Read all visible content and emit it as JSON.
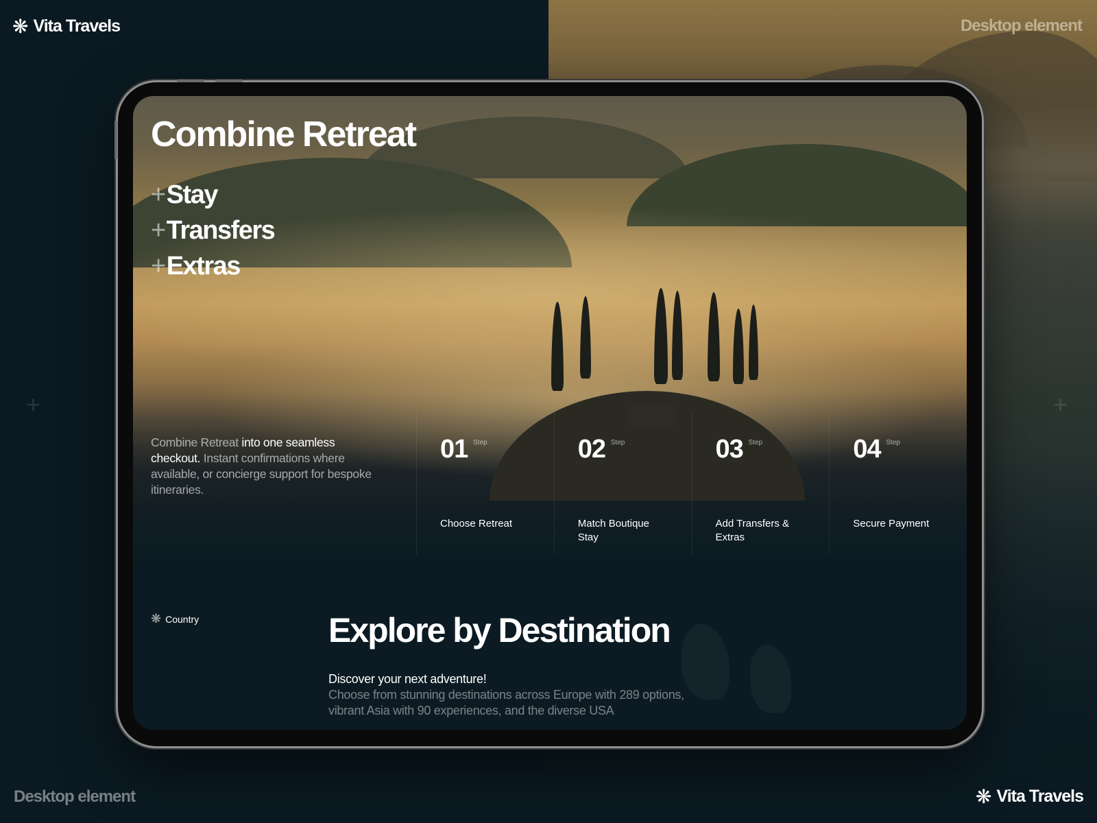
{
  "brand": {
    "name": "Vita Travels",
    "icon": "snowflake-asterisk-icon",
    "glyph": "❋"
  },
  "corner_labels": {
    "top_right": "Desktop element",
    "bottom_left": "Desktop element"
  },
  "hero": {
    "title": "Combine Retreat",
    "items": [
      {
        "plus": "+",
        "label": "Stay"
      },
      {
        "plus": "+",
        "label": "Transfers"
      },
      {
        "plus": "+",
        "label": "Extras"
      }
    ]
  },
  "info": {
    "part1": "Combine Retreat ",
    "part2": "into one seamless checkout.",
    "part3": " Instant confirmations where available, or concierge support for bespoke itineraries."
  },
  "steps": [
    {
      "number": "01",
      "tag": "Step",
      "label": "Choose Retreat"
    },
    {
      "number": "02",
      "tag": "Step",
      "label": "Match Boutique Stay"
    },
    {
      "number": "03",
      "tag": "Step",
      "label": "Add Transfers & Extras"
    },
    {
      "number": "04",
      "tag": "Step",
      "label": "Secure Payment"
    }
  ],
  "destination": {
    "tag": "Country",
    "tag_glyph": "❋",
    "title": "Explore by Destination",
    "subtitle": "Discover your next adventure!",
    "description": "Choose from stunning destinations across Europe with 289 options, vibrant Asia with 90 experiences, and the diverse USA"
  },
  "colors": {
    "background": "#0b1a22",
    "text": "#ffffff",
    "muted": "#9aa3a7"
  }
}
